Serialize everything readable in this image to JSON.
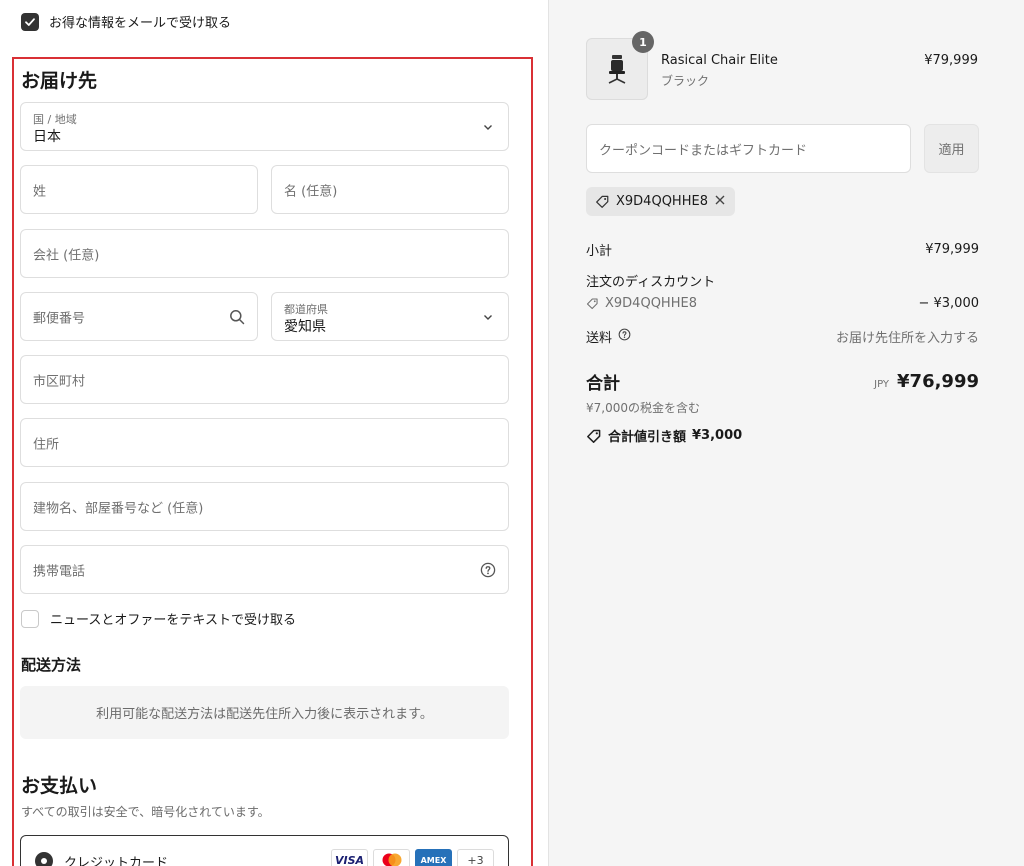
{
  "newsletter": {
    "checked": true,
    "label": "お得な情報をメールで受け取る"
  },
  "delivery": {
    "title": "お届け先",
    "country": {
      "label": "国 / 地域",
      "value": "日本"
    },
    "last_name": {
      "placeholder": "姓"
    },
    "first_name": {
      "placeholder": "名 (任意)"
    },
    "company": {
      "placeholder": "会社 (任意)"
    },
    "postal": {
      "placeholder": "郵便番号"
    },
    "prefecture": {
      "label": "都道府県",
      "value": "愛知県"
    },
    "city": {
      "placeholder": "市区町村"
    },
    "address": {
      "placeholder": "住所"
    },
    "building": {
      "placeholder": "建物名、部屋番号など (任意)"
    },
    "phone": {
      "placeholder": "携帯電話"
    },
    "sms_opt": {
      "checked": false,
      "label": "ニュースとオファーをテキストで受け取る"
    }
  },
  "shipping": {
    "title": "配送方法",
    "notice": "利用可能な配送方法は配送先住所入力後に表示されます。"
  },
  "payment": {
    "title": "お支払い",
    "subtitle": "すべての取引は安全で、暗号化されています。",
    "method_label": "クレジットカード",
    "brands": [
      "VISA",
      "MC",
      "AMEX",
      "+3"
    ]
  },
  "summary": {
    "product": {
      "name": "Rasical Chair Elite",
      "variant": "ブラック",
      "price": "¥79,999",
      "quantity": "1"
    },
    "coupon_placeholder": "クーポンコードまたはギフトカード",
    "apply_label": "適用",
    "applied_code": "X9D4QQHHE8",
    "subtotal_label": "小計",
    "subtotal_value": "¥79,999",
    "discount_label": "注文のディスカウント",
    "discount_code": "X9D4QQHHE8",
    "discount_value": "− ¥3,000",
    "shipping_label": "送料",
    "shipping_value": "お届け先住所を入力する",
    "total_label": "合計",
    "total_currency": "JPY",
    "total_value": "¥76,999",
    "tax_note": "¥7,000の税金を含む",
    "savings_label": "合計値引き額",
    "savings_value": "¥3,000"
  }
}
